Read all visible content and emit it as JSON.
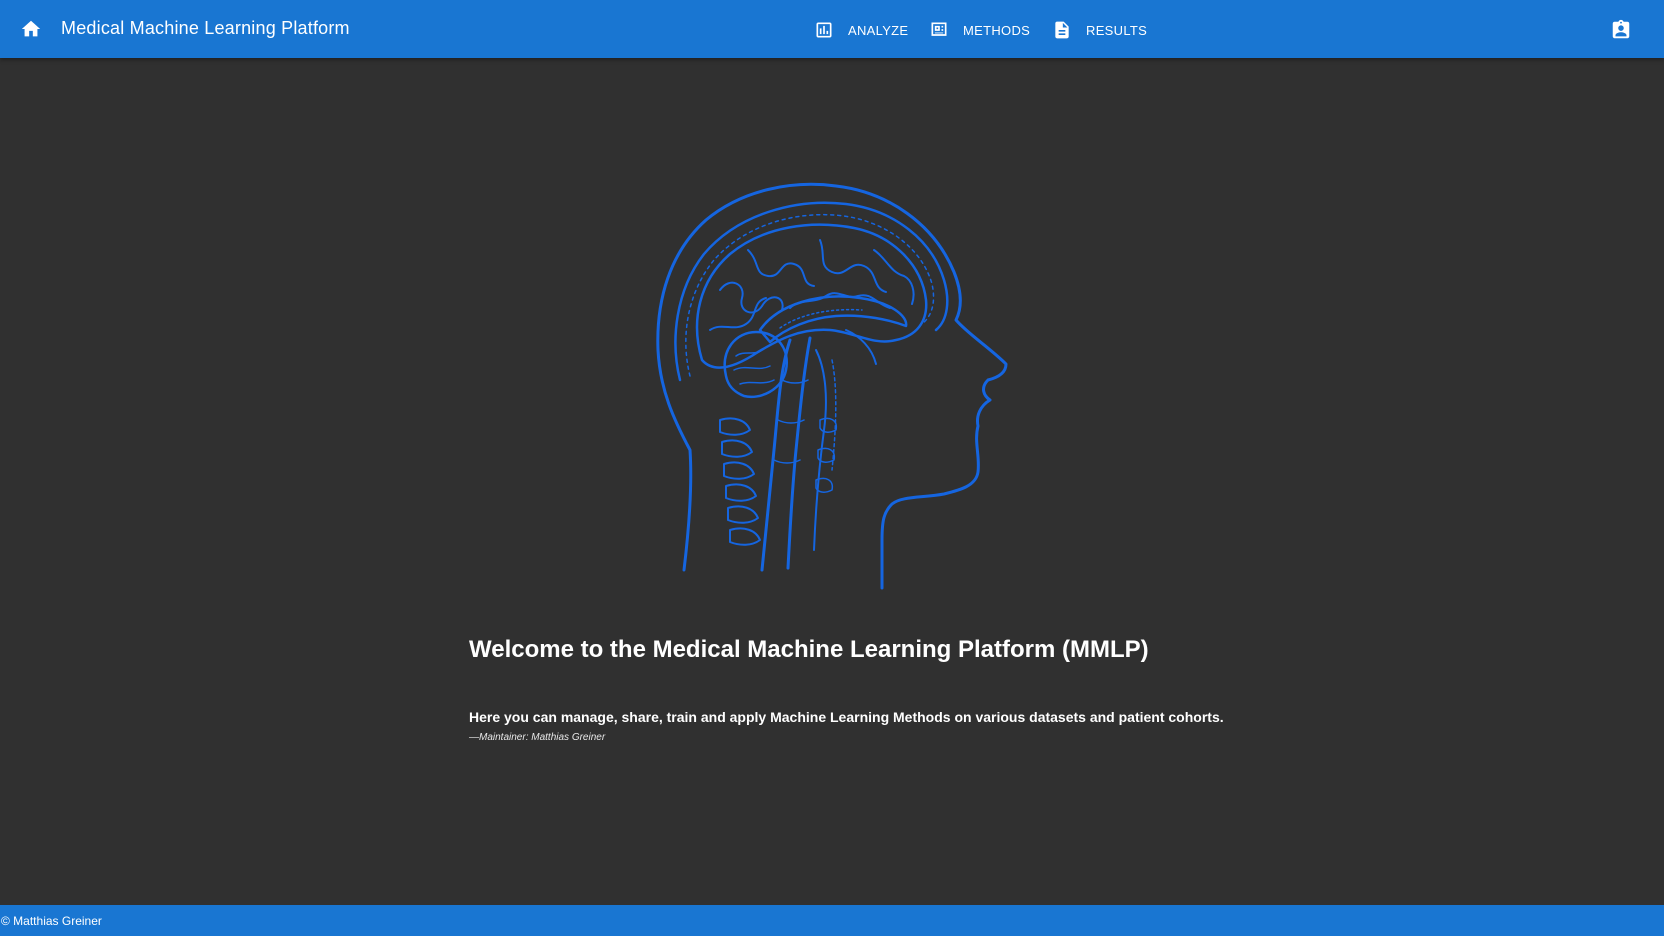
{
  "app": {
    "title": "Medical Machine Learning Platform",
    "brand_color": "#1976d2",
    "background_color": "#303030"
  },
  "toolbar": {
    "home_icon": "home-icon",
    "profile_icon": "assignment-ind-icon",
    "nav": [
      {
        "label": "ANALYZE",
        "icon": "bar-chart-icon"
      },
      {
        "label": "METHODS",
        "icon": "dynamic-feed-icon"
      },
      {
        "label": "RESULTS",
        "icon": "description-icon"
      }
    ]
  },
  "hero": {
    "image": "brain-head-illustration",
    "line_color": "#1565e0"
  },
  "main": {
    "heading": "Welcome to the Medical Machine Learning Platform (MMLP)",
    "quote": "Here you can manage, share, train and apply Machine Learning Methods on various datasets and patient cohorts.",
    "attribution": "—Maintainer: Matthias Greiner"
  },
  "footer": {
    "copyright": "© Matthias Greiner"
  }
}
